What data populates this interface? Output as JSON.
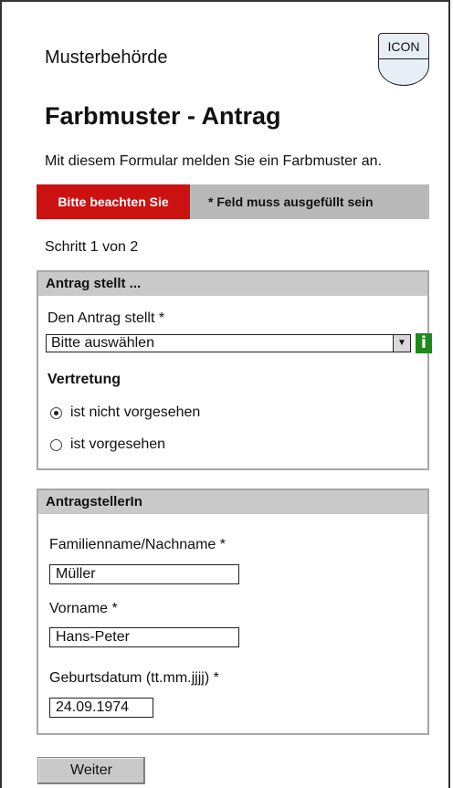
{
  "header": {
    "authority": "Musterbehörde",
    "logo_text": "ICON",
    "title": "Farbmuster - Antrag",
    "intro": "Mit diesem Formular melden Sie ein Farbmuster an."
  },
  "notice": {
    "label": "Bitte beachten Sie",
    "text": "* Feld muss ausgefüllt sein"
  },
  "step": "Schritt 1 von 2",
  "applicant_section": {
    "header": "Antrag stellt ...",
    "field_label": "Den Antrag stellt *",
    "select_value": "Bitte auswählen",
    "info_icon": "i",
    "representation_title": "Vertretung",
    "options": [
      {
        "label": "ist nicht vorgesehen",
        "checked": true
      },
      {
        "label": "ist vorgesehen",
        "checked": false
      }
    ]
  },
  "person_section": {
    "header": "AntragstellerIn",
    "lastname_label": "Familienname/Nachname *",
    "lastname_value": "Müller",
    "firstname_label": "Vorname *",
    "firstname_value": "Hans-Peter",
    "birthdate_label": "Geburtsdatum (tt.mm.jjjj) *",
    "birthdate_value": "24.09.1974"
  },
  "actions": {
    "next_label": "Weiter"
  },
  "colors": {
    "notice_label_bg": "#cc1111",
    "notice_text_bg": "#b9b9b9",
    "info_icon_bg": "#1d8a1d",
    "panel_header_bg": "#c9c9c9"
  }
}
